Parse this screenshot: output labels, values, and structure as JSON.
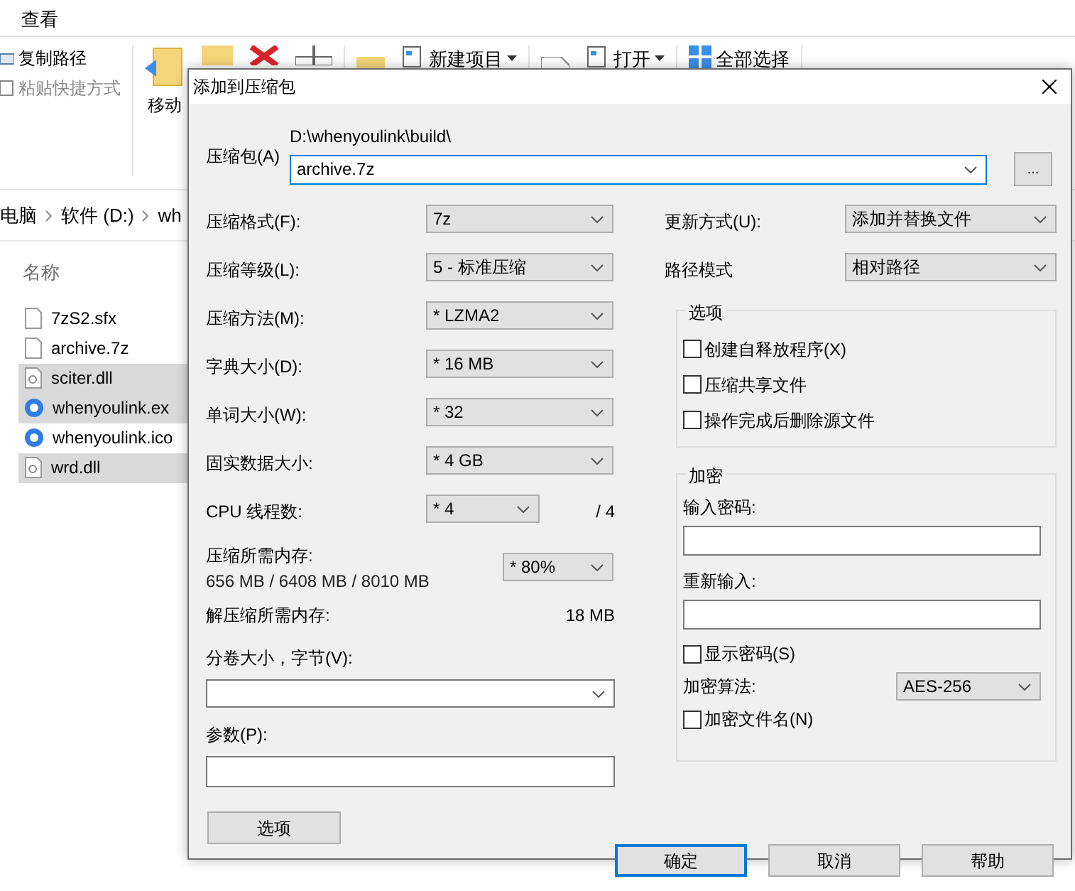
{
  "explorer": {
    "ribbon_tab": "查看",
    "clipboard_items": [
      {
        "label": "复制路径",
        "disabled": false
      },
      {
        "label": "粘贴快捷方式",
        "disabled": true
      }
    ],
    "move_button": {
      "label": "移动"
    },
    "ribbon_buttons": [
      {
        "label": "新建项目",
        "dropdown": true
      },
      {
        "label": "打开",
        "dropdown": true
      },
      {
        "label": "全部选择",
        "dropdown": false
      }
    ],
    "breadcrumb": [
      "电脑",
      "软件 (D:)",
      "wh"
    ],
    "column_header": "名称",
    "files": [
      {
        "name": "7zS2.sfx",
        "kind": "document",
        "selected": false
      },
      {
        "name": "archive.7z",
        "kind": "document",
        "selected": false
      },
      {
        "name": "sciter.dll",
        "kind": "library",
        "selected": true
      },
      {
        "name": "whenyoulink.ex",
        "kind": "app",
        "selected": true
      },
      {
        "name": "whenyoulink.ico",
        "kind": "app",
        "selected": false
      },
      {
        "name": "wrd.dll",
        "kind": "library",
        "selected": true
      }
    ]
  },
  "dialog": {
    "title": "添加到压缩包",
    "archive": {
      "label": "压缩包(A)",
      "path": "D:\\whenyoulink\\build\\",
      "value": "archive.7z"
    },
    "browse_button": "...",
    "left_settings": [
      {
        "kind": "select",
        "label": "压缩格式(F):",
        "value": "7z"
      },
      {
        "kind": "select",
        "label": "压缩等级(L):",
        "value": "5 - 标准压缩"
      },
      {
        "kind": "select",
        "label": "压缩方法(M):",
        "value": "* LZMA2"
      },
      {
        "kind": "select",
        "label": "字典大小(D):",
        "value": "* 16 MB"
      },
      {
        "kind": "select",
        "label": "单词大小(W):",
        "value": "* 32"
      },
      {
        "kind": "select",
        "label": "固实数据大小:",
        "value": "* 4 GB"
      },
      {
        "kind": "threads",
        "label": "CPU 线程数:",
        "value": "* 4",
        "note": "/ 4"
      },
      {
        "kind": "memory",
        "label": "压缩所需内存:",
        "detail": "656 MB / 6408 MB / 8010 MB",
        "value": "* 80%"
      },
      {
        "kind": "info",
        "label": "解压缩所需内存:",
        "note": "18 MB"
      }
    ],
    "volume": {
      "label": "分卷大小，字节(V):"
    },
    "parameters": {
      "label": "参数(P):"
    },
    "options_button": "选项",
    "right_settings": [
      {
        "label": "更新方式(U):",
        "value": "添加并替换文件"
      },
      {
        "label": "路径模式",
        "value": "相对路径"
      }
    ],
    "options_group": {
      "title": "选项",
      "checkboxes": [
        {
          "label": "创建自释放程序(X)",
          "checked": false
        },
        {
          "label": "压缩共享文件",
          "checked": false
        },
        {
          "label": "操作完成后删除源文件",
          "checked": false
        }
      ]
    },
    "encryption": {
      "title": "加密",
      "password_label": "输入密码:",
      "reenter_label": "重新输入:",
      "show_password": {
        "label": "显示密码(S)",
        "checked": false
      },
      "method_label": "加密算法:",
      "method_value": "AES-256",
      "encrypt_names": {
        "label": "加密文件名(N)",
        "checked": false
      }
    },
    "buttons": [
      {
        "label": "确定",
        "default": true
      },
      {
        "label": "取消",
        "default": false
      },
      {
        "label": "帮助",
        "default": false
      }
    ]
  }
}
